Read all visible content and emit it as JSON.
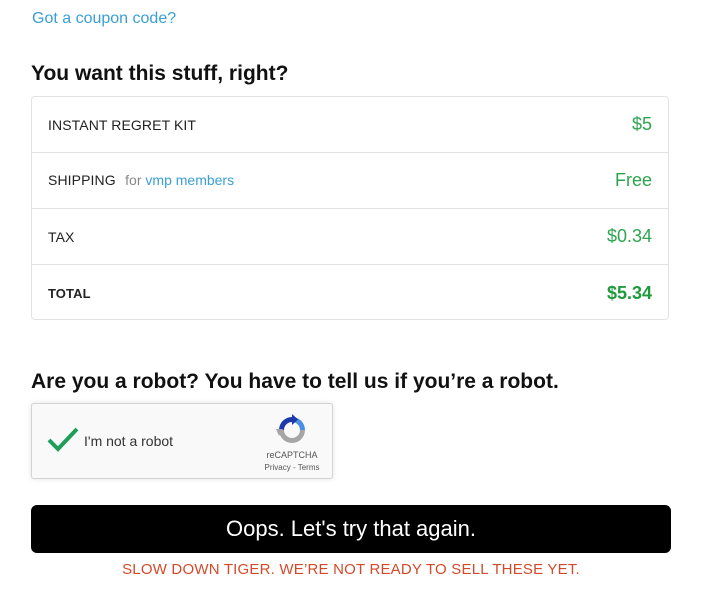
{
  "coupon": {
    "link_text": "Got a coupon code?"
  },
  "order": {
    "title": "You want this stuff, right?",
    "rows": [
      {
        "label": "INSTANT REGRET KIT",
        "value": "$5"
      },
      {
        "label": "SHIPPING",
        "sub_prefix": "for",
        "sub_link": "vmp members",
        "value": "Free"
      },
      {
        "label": "TAX",
        "value": "$0.34"
      },
      {
        "label": "TOTAL",
        "value": "$5.34"
      }
    ]
  },
  "robot": {
    "title": "Are you a robot? You have to tell us if you’re a robot.",
    "checkbox_label": "I'm not a robot",
    "checked": true,
    "brand": "reCAPTCHA",
    "privacy": "Privacy",
    "separator": " - ",
    "terms": "Terms"
  },
  "actions": {
    "button_label": "Oops. Let's try that again.",
    "error_message": "SLOW DOWN TIGER. WE’RE NOT READY TO SELL THESE YET."
  },
  "colors": {
    "link": "#3a9fd6",
    "price": "#2ea44f",
    "check": "#1e9e5a",
    "error": "#d34a2a",
    "button_bg": "#000000"
  },
  "icons": {
    "checkmark": "checkmark-icon",
    "recaptcha_logo": "recaptcha-logo-icon"
  }
}
